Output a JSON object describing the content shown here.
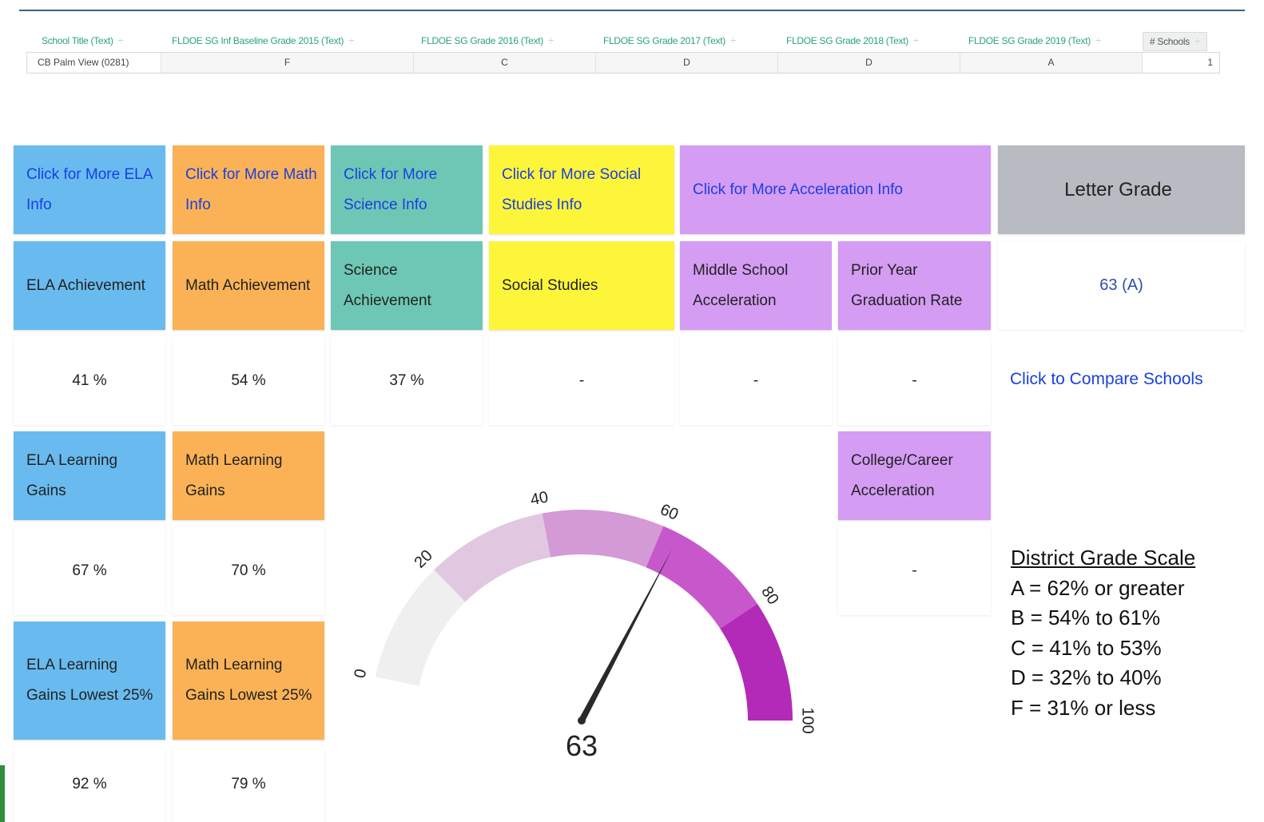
{
  "filter_table": {
    "headers": [
      "School Title (Text)",
      "FLDOE SG Inf Baseline Grade 2015 (Text)",
      "FLDOE SG Grade 2016 (Text)",
      "FLDOE SG Grade 2017 (Text)",
      "FLDOE SG Grade 2018 (Text)",
      "FLDOE SG Grade 2019 (Text)",
      "# Schools"
    ],
    "sort_glyph": "÷",
    "row": [
      "CB Palm View (0281)",
      "F",
      "C",
      "D",
      "D",
      "A",
      "1"
    ]
  },
  "info_links": {
    "ela": "Click for More ELA Info",
    "math": "Click for More Math Info",
    "science": "Click for More Science Info",
    "social_studies": "Click for More Social Studies Info",
    "acceleration": "Click for More Acceleration Info"
  },
  "letter_grade": {
    "header": "Letter Grade",
    "value": "63 (A)",
    "compare_link": "Click to Compare Schools"
  },
  "metrics": {
    "ela_achievement": {
      "label": "ELA Achievement",
      "value": "41 %"
    },
    "math_achievement": {
      "label": "Math Achievement",
      "value": "54 %"
    },
    "science_achievement": {
      "label": "Science Achievement",
      "value": "37 %"
    },
    "social_studies": {
      "label": "Social Studies",
      "value": "-"
    },
    "middle_school_acceleration": {
      "label": "Middle School Acceleration",
      "value": "-"
    },
    "prior_year_graduation": {
      "label": "Prior Year Graduation Rate",
      "value": "-"
    },
    "ela_learning_gains": {
      "label": "ELA Learning Gains",
      "value": "67 %"
    },
    "math_learning_gains": {
      "label": "Math Learning Gains",
      "value": "70 %"
    },
    "college_career": {
      "label": "College/Career Acceleration",
      "value": "-"
    },
    "ela_lowest": {
      "label": "ELA Learning Gains Lowest 25%",
      "value": "92 %"
    },
    "math_lowest": {
      "label": "Math Learning Gains Lowest 25%",
      "value": "79 %"
    }
  },
  "gauge": {
    "value": 63,
    "min": 0,
    "max": 100,
    "ticks": [
      "0",
      "20",
      "40",
      "60",
      "80",
      "100"
    ],
    "band_colors": [
      "#efefef",
      "#e1c8e1",
      "#d39ad6",
      "#c758cc",
      "#b329b8"
    ],
    "needle_color": "#2a2a2a"
  },
  "district_scale": {
    "title": "District Grade Scale",
    "lines": [
      "A = 62% or greater",
      "B = 54% to 61%",
      "C = 41% to 53%",
      "D = 32% to 40%",
      "F = 31% or less"
    ]
  },
  "colors": {
    "ela": "#69bbef",
    "math": "#fbb256",
    "science": "#6ec7b5",
    "social_studies": "#fdf53a",
    "acceleration": "#d49cf3",
    "letter_grade": "#b8bcc2",
    "link": "#1a3fe0",
    "header_text": "#2aa37e"
  }
}
